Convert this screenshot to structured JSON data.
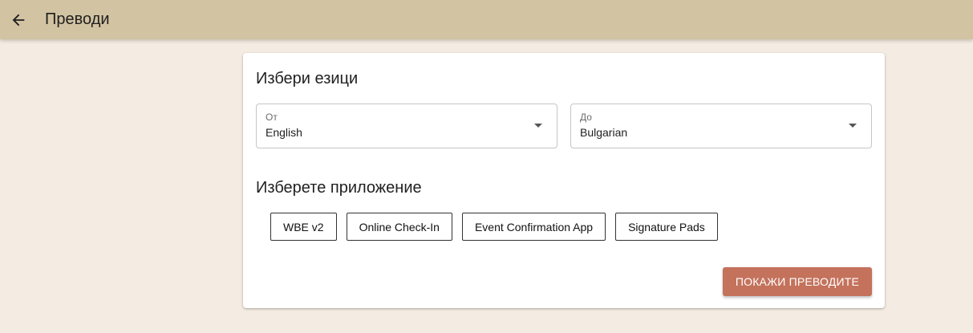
{
  "header": {
    "title": "Преводи",
    "back_icon": "arrow-left-icon"
  },
  "languages": {
    "title": "Избери езици",
    "from": {
      "label": "От",
      "value": "English"
    },
    "to": {
      "label": "До",
      "value": "Bulgarian"
    }
  },
  "applications": {
    "title": "Изберете приложение",
    "items": [
      {
        "label": "WBE v2"
      },
      {
        "label": "Online Check-In"
      },
      {
        "label": "Event Confirmation App"
      },
      {
        "label": "Signature Pads"
      }
    ]
  },
  "actions": {
    "show_label": "Покажи преводите"
  },
  "colors": {
    "header_bg": "#d2c3a2",
    "page_bg": "#f4ebe2",
    "accent": "#c4725c"
  }
}
